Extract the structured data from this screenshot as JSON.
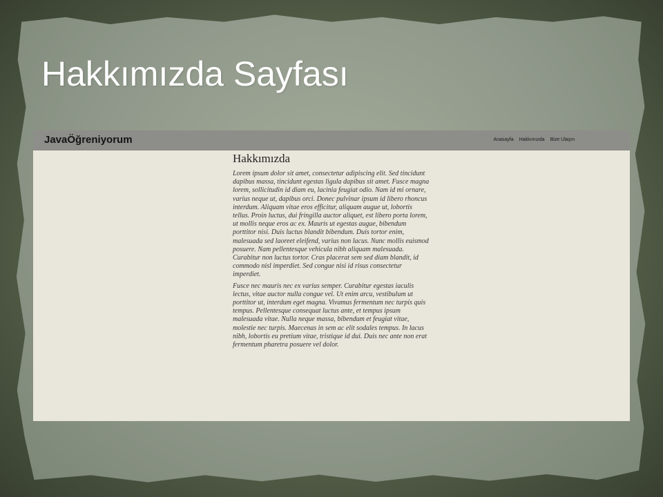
{
  "slide": {
    "title": "Hakkımızda Sayfası"
  },
  "site": {
    "brand": "JavaÖğreniyorum",
    "nav": [
      "Anasayfa",
      "Hakkımızda",
      "Bize Ulaşın"
    ],
    "content": {
      "heading": "Hakkımızda",
      "paragraphs": [
        "Lorem ipsum dolor sit amet, consectetur adipiscing elit. Sed tincidunt dapibus massa, tincidunt egestas ligula dapibus sit amet. Fusce magna lorem, sollicitudin id diam eu, lacinia feugiat odio. Nam id mi ornare, varius neque ut, dapibus orci. Donec pulvinar ipsum id libero rhoncus interdum. Aliquam vitae eros efficitur, aliquam augue ut, lobortis tellus. Proin luctus, dui fringilla auctor aliquet, est libero porta lorem, ut mollis neque eros ac ex. Mauris ut egestas augue, bibendum porttitor nisi. Duis luctus blandit bibendum. Duis tortor enim, malesuada sed laoreet eleifend, varius non lacus. Nunc mollis euismod posuere. Nam pellentesque vehicula nibh aliquam malesuada. Curabitur non luctus tortor. Cras placerat sem sed diam blandit, id commodo nisl imperdiet. Sed congue nisi id risus consectetur imperdiet.",
        "Fusce nec mauris nec ex varius semper. Curabitur egestas iaculis lectus, vitae auctor nulla congue vel. Ut enim arcu, vestibulum ut porttitor ut, interdum eget magna. Vivamus fermentum nec turpis quis tempus. Pellentesque consequat luctus ante, et tempus ipsum malesuada vitae. Nulla neque massa, bibendum et feugiat vitae, molestie nec turpis. Maecenas in sem ac elit sodales tempus. In lacus nibh, lobortis eu pretium vitae, tristique id dui. Duis nec ante non erat fermentum pharetra posuere vel dolor."
      ]
    }
  }
}
